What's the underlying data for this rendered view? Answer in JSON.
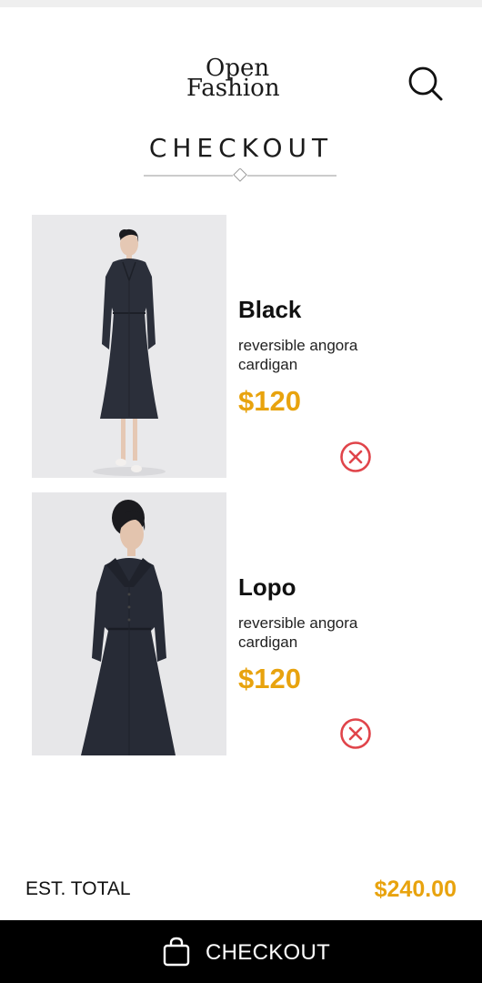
{
  "header": {
    "logo_line1": "Open",
    "logo_line2": "Fashion",
    "search_icon": "search-icon"
  },
  "page": {
    "title": "CHECKOUT"
  },
  "items": [
    {
      "name": "Black",
      "description": "reversible angora cardigan",
      "price": "$120",
      "remove_icon": "close-circle-icon"
    },
    {
      "name": "Lopo",
      "description": "reversible angora cardigan",
      "price": "$120",
      "remove_icon": "close-circle-icon"
    }
  ],
  "summary": {
    "total_label": "EST. TOTAL",
    "total_value": "$240.00"
  },
  "checkout_bar": {
    "label": "CHECKOUT",
    "icon": "shopping-bag-icon"
  },
  "colors": {
    "price_accent": "#E8A30E",
    "remove_red": "#E0444A",
    "bar_background": "#000000"
  }
}
